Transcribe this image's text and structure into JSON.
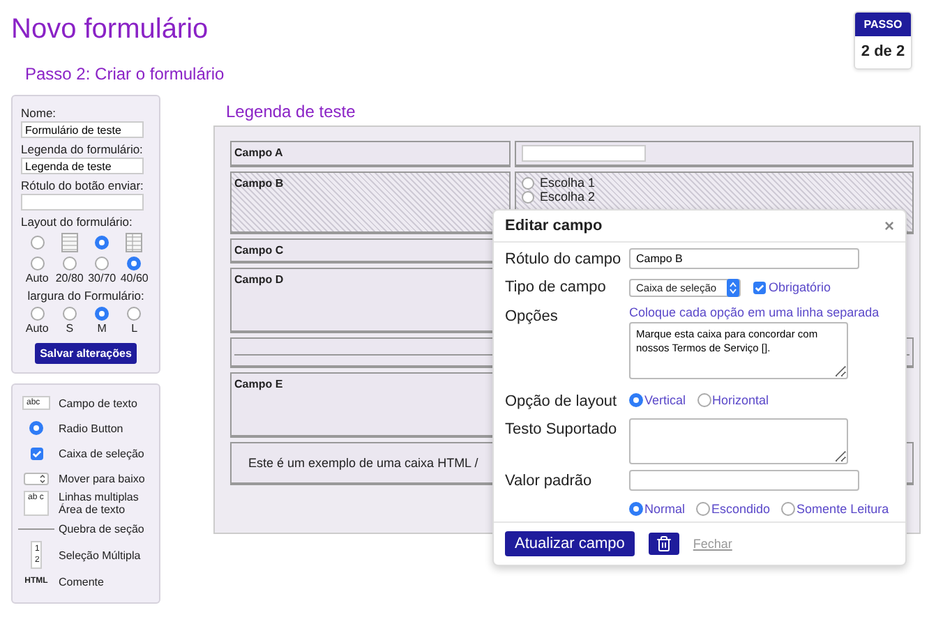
{
  "header": {
    "title": "Novo formulário",
    "step_label": "PASSO",
    "step_value": "2 de 2",
    "subtitle": "Passo 2: Criar o formulário"
  },
  "settings": {
    "name_label": "Nome:",
    "name_value": "Formulário de teste",
    "caption_label": "Legenda do formulário:",
    "caption_value": "Legenda de teste",
    "submit_label": "Rótulo do botão enviar:",
    "layout_label": "Layout do formulário:",
    "layout_styles": [
      {
        "selected": false
      },
      {
        "selected": true
      }
    ],
    "layout_widths": [
      {
        "label": "Auto",
        "selected": false
      },
      {
        "label": "20/80",
        "selected": false
      },
      {
        "label": "30/70",
        "selected": false
      },
      {
        "label": "40/60",
        "selected": true
      }
    ],
    "width_label": "largura do Formulário:",
    "form_widths": [
      {
        "label": "Auto",
        "selected": false
      },
      {
        "label": "S",
        "selected": false
      },
      {
        "label": "M",
        "selected": true
      },
      {
        "label": "L",
        "selected": false
      }
    ],
    "save_button": "Salvar alterações"
  },
  "palette": [
    {
      "kind": "text",
      "icon_text": "abc",
      "label": "Campo de texto"
    },
    {
      "kind": "radio",
      "label": "Radio Button"
    },
    {
      "kind": "checkbox",
      "label": "Caixa de seleção"
    },
    {
      "kind": "select",
      "label": "Mover para baixo"
    },
    {
      "kind": "textarea",
      "icon_text": "ab c",
      "label": "Linhas multiplas Área de texto"
    },
    {
      "kind": "break",
      "label": "Quebra de seção"
    },
    {
      "kind": "multiselect",
      "icon_text": "1 2",
      "label": "Seleção Múltipla"
    },
    {
      "kind": "html",
      "icon_text": "HTML",
      "label": "Comente"
    }
  ],
  "canvas": {
    "caption": "Legenda de teste",
    "rows": [
      {
        "kind": "input",
        "label": "Campo A"
      },
      {
        "kind": "radios",
        "label": "Campo B",
        "highlighted": true,
        "choices": [
          {
            "label": "Escolha 1",
            "selected": false
          },
          {
            "label": "Escolha 2",
            "selected": false
          }
        ]
      },
      {
        "kind": "field",
        "label": "Campo C"
      },
      {
        "kind": "tallfield",
        "label": "Campo D"
      },
      {
        "kind": "break"
      },
      {
        "kind": "tallfield",
        "label": "Campo E"
      },
      {
        "kind": "html",
        "text": "Este é um exemplo de uma caixa HTML /"
      }
    ]
  },
  "dialog": {
    "title": "Editar campo",
    "close": "×",
    "label_label": "Rótulo do campo",
    "label_value": "Campo B",
    "type_label": "Tipo de campo",
    "type_value": "Caixa de seleção",
    "required_label": "Obrigatório",
    "required_checked": true,
    "options_label": "Opções",
    "options_hint": "Coloque cada opção em uma linha separada",
    "options_value": "Marque esta caixa para concordar com nossos Termos de Serviço [].",
    "layout_label": "Opção de layout",
    "layout_options": [
      {
        "label": "Vertical",
        "selected": true
      },
      {
        "label": "Horizontal",
        "selected": false
      }
    ],
    "help_label": "Testo Suportado",
    "default_label": "Valor padrão",
    "modes": [
      {
        "label": "Normal",
        "selected": true
      },
      {
        "label": "Escondido",
        "selected": false
      },
      {
        "label": "Somente Leitura",
        "selected": false
      }
    ],
    "update_button": "Atualizar campo",
    "close_link": "Fechar"
  }
}
